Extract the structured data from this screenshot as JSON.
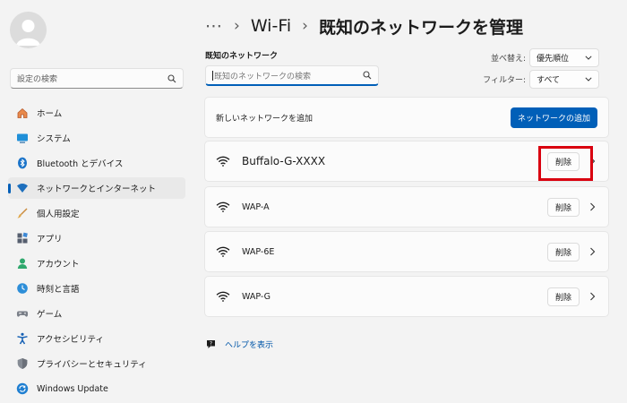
{
  "sidebar": {
    "search_placeholder": "設定の検索",
    "items": [
      {
        "label": "ホーム",
        "icon": "home-icon"
      },
      {
        "label": "システム",
        "icon": "system-icon"
      },
      {
        "label": "Bluetooth とデバイス",
        "icon": "bluetooth-icon"
      },
      {
        "label": "ネットワークとインターネット",
        "icon": "network-icon",
        "selected": true
      },
      {
        "label": "個人用設定",
        "icon": "brush-icon"
      },
      {
        "label": "アプリ",
        "icon": "apps-icon"
      },
      {
        "label": "アカウント",
        "icon": "account-icon"
      },
      {
        "label": "時刻と言語",
        "icon": "clock-globe-icon"
      },
      {
        "label": "ゲーム",
        "icon": "gamepad-icon"
      },
      {
        "label": "アクセシビリティ",
        "icon": "accessibility-icon"
      },
      {
        "label": "プライバシーとセキュリティ",
        "icon": "shield-icon"
      },
      {
        "label": "Windows Update",
        "icon": "windows-update-icon"
      }
    ]
  },
  "header": {
    "breadcrumb": {
      "overflow": "⋯",
      "separator": "›",
      "parent": "Wi-Fi",
      "current": "既知のネットワークを管理"
    }
  },
  "main": {
    "known_networks_label": "既知のネットワーク",
    "search_placeholder": "既知のネットワークの検索",
    "sort": {
      "label": "並べ替え:",
      "value": "優先順位"
    },
    "filter": {
      "label": "フィルター:",
      "value": "すべて"
    },
    "add_network": {
      "text": "新しいネットワークを追加",
      "button": "ネットワークの追加"
    },
    "networks": [
      {
        "name": "Buffalo-G-XXXX",
        "delete_label": "削除"
      },
      {
        "name": "WAP-A",
        "delete_label": "削除"
      },
      {
        "name": "WAP-6E",
        "delete_label": "削除"
      },
      {
        "name": "WAP-G",
        "delete_label": "削除"
      }
    ],
    "help_link": "ヘルプを表示"
  },
  "colors": {
    "accent": "#005fb8",
    "highlight_box": "#d9000f",
    "background": "#f3f3f3",
    "card": "#fbfbfb"
  }
}
